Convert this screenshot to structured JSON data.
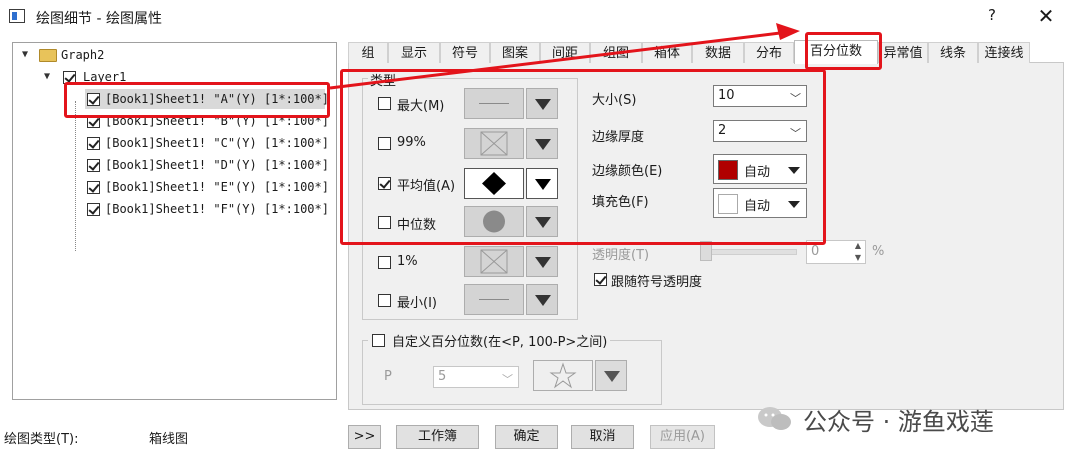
{
  "window": {
    "title": "绘图细节 - 绘图属性",
    "help": "?",
    "close": "✕"
  },
  "tree": {
    "root": "Graph2",
    "layer": "Layer1",
    "items": [
      "[Book1]Sheet1! \"A\"(Y) [1*:100*]",
      "[Book1]Sheet1! \"B\"(Y) [1*:100*]",
      "[Book1]Sheet1! \"C\"(Y) [1*:100*]",
      "[Book1]Sheet1! \"D\"(Y) [1*:100*]",
      "[Book1]Sheet1! \"E\"(Y) [1*:100*]",
      "[Book1]Sheet1! \"F\"(Y) [1*:100*]"
    ]
  },
  "tabs": [
    "组",
    "显示",
    "符号",
    "图案",
    "间距",
    "组图",
    "箱体",
    "数据",
    "分布",
    "百分位数",
    "异常值",
    "线条",
    "连接线"
  ],
  "active_tab": "百分位数",
  "type_group": {
    "title": "类型",
    "rows": [
      {
        "label": "最大(M)",
        "checked": false,
        "symbol": "dash"
      },
      {
        "label": "99%",
        "checked": false,
        "symbol": "cross"
      },
      {
        "label": "平均值(A)",
        "checked": true,
        "symbol": "diamond"
      },
      {
        "label": "中位数",
        "checked": false,
        "symbol": "circle"
      },
      {
        "label": "1%",
        "checked": false,
        "symbol": "cross"
      },
      {
        "label": "最小(I)",
        "checked": false,
        "symbol": "dash"
      }
    ]
  },
  "props": {
    "size_label": "大小(S)",
    "size_value": "10",
    "edge_thickness_label": "边缘厚度",
    "edge_thickness_value": "2",
    "edge_color_label": "边缘颜色(E)",
    "edge_color_value": "自动",
    "edge_color_hex": "#b00000",
    "fill_color_label": "填充色(F)",
    "fill_color_value": "自动",
    "fill_color_hex": "#ffffff",
    "transparency_label": "透明度(T)",
    "transparency_value": "0",
    "transparency_unit": "%",
    "follow_label": "跟随符号透明度",
    "follow_checked": true
  },
  "custom_group": {
    "title": "自定义百分位数(在<P, 100-P>之间)",
    "checked": false,
    "p_label": "P",
    "p_value": "5"
  },
  "footer": {
    "plot_type_label": "绘图类型(T):",
    "plot_type_value": "箱线图",
    "expand": ">>",
    "workbook": "工作簿",
    "ok": "确定",
    "cancel": "取消",
    "apply": "应用(A)"
  },
  "watermark": "公众号 · 游鱼戏莲",
  "colors": {
    "highlight": "#e3141b",
    "accent": "#2e6fcf"
  }
}
